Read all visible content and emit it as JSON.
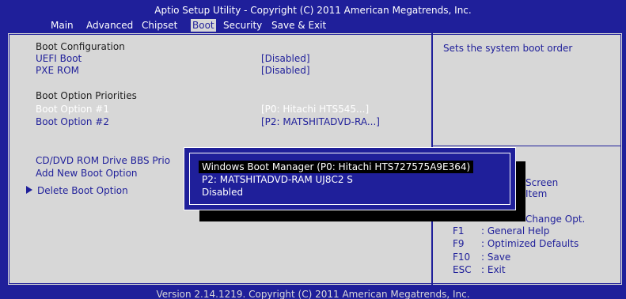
{
  "header": {
    "title": "Aptio Setup Utility - Copyright (C) 2011 American Megatrends, Inc.",
    "tabs": [
      "Main",
      "Advanced",
      "Chipset",
      "Boot",
      "Security",
      "Save & Exit"
    ],
    "active_tab": "Boot"
  },
  "left": {
    "section_boot_config": "Boot Configuration",
    "uefi_boot_label": "UEFI Boot",
    "uefi_boot_value": "[Disabled]",
    "pxe_rom_label": "PXE ROM",
    "pxe_rom_value": "[Disabled]",
    "section_priorities": "Boot Option Priorities",
    "boot_option_1_label": "Boot Option #1",
    "boot_option_1_value": "[P0:  Hitachi HTS545...]",
    "boot_option_2_label": "Boot Option #2",
    "boot_option_2_value": "[P2: MATSHITADVD-RA...]",
    "cd_dvd_label": "CD/DVD ROM Drive BBS Prio",
    "add_new_label": "Add New Boot Option",
    "delete_label": "Delete Boot Option"
  },
  "popup": {
    "options": [
      "Windows Boot Manager (P0: Hitachi HTS727575A9E364)",
      "P2: MATSHITADVD-RAM UJ8C2 S",
      "Disabled"
    ],
    "selected_index": 0
  },
  "help": {
    "text": "Sets the system boot order",
    "partial_1": "Screen",
    "partial_2": "Item",
    "partial_3": "Change Opt.",
    "keys": [
      {
        "key": "F1",
        "desc": ": General Help"
      },
      {
        "key": "F9",
        "desc": ": Optimized Defaults"
      },
      {
        "key": "F10",
        "desc": ": Save"
      },
      {
        "key": "ESC",
        "desc": ": Exit"
      }
    ]
  },
  "footer": {
    "text": "Version 2.14.1219. Copyright (C) 2011 American Megatrends, Inc."
  },
  "colors": {
    "background": "#1f1f9a",
    "panel": "#d7d7d7",
    "highlight_text": "#ffffff",
    "selection": "#000000"
  }
}
